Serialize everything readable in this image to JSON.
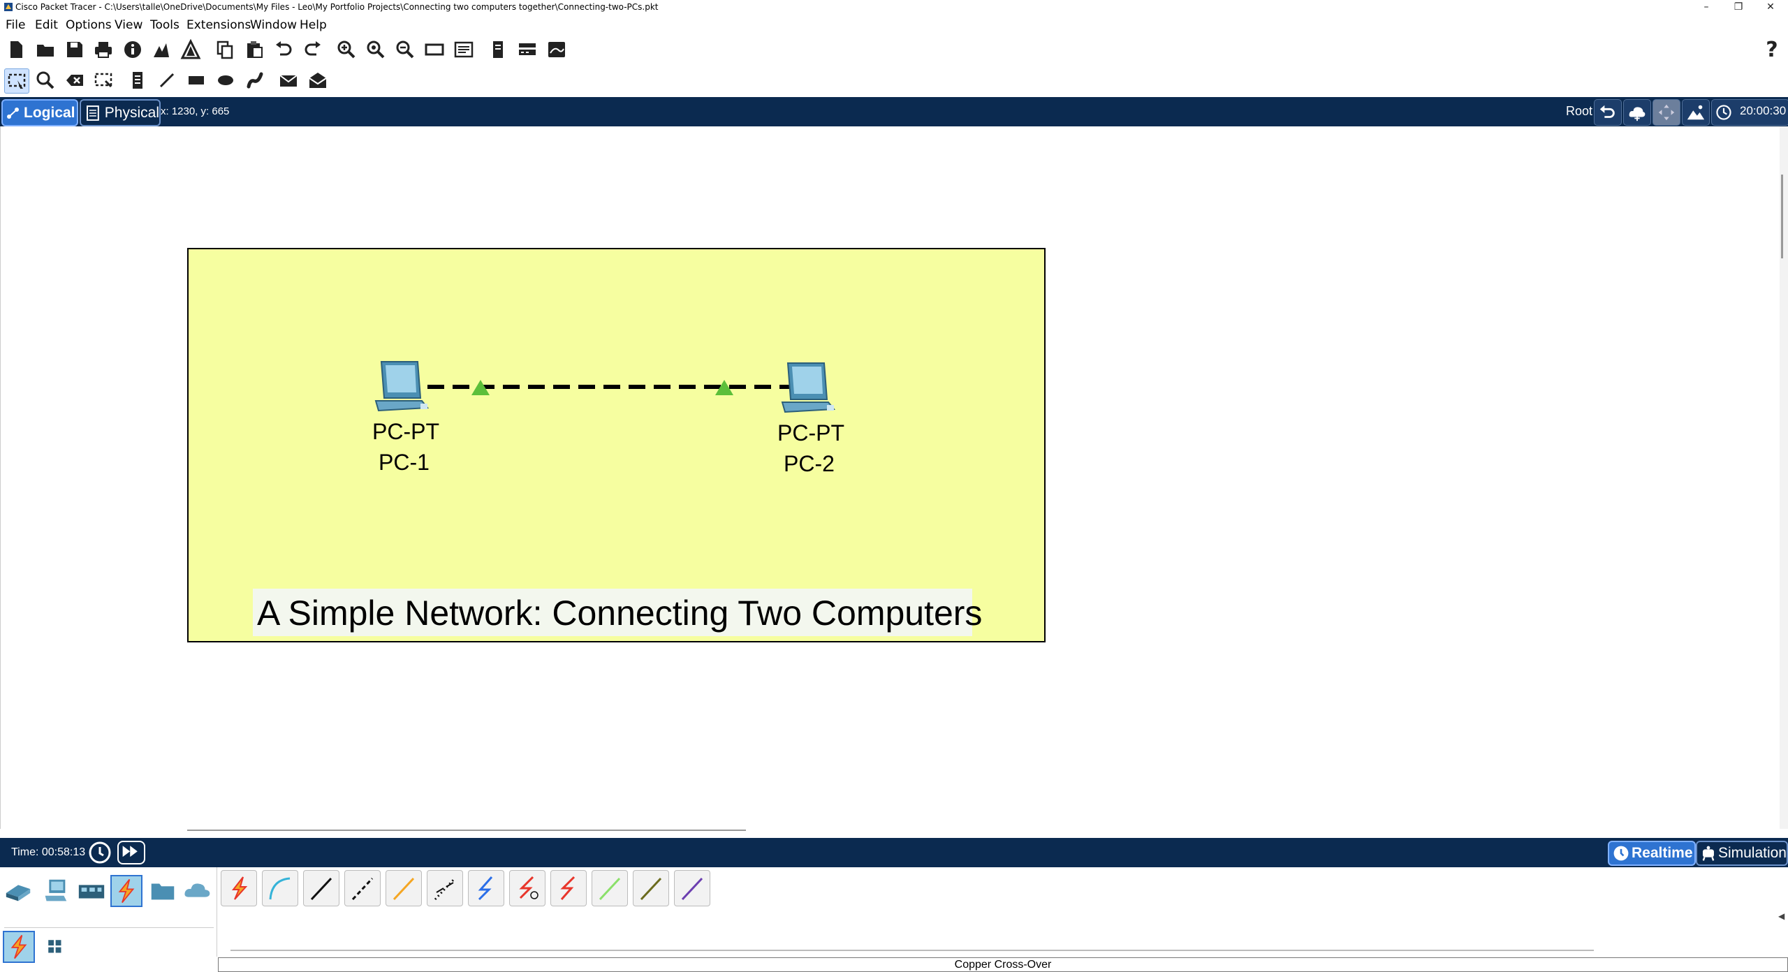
{
  "titlebar": {
    "title": "Cisco Packet Tracer - C:\\Users\\talle\\OneDrive\\Documents\\My Files - Leo\\My Portfolio Projects\\Connecting two computers together\\Connecting-two-PCs.pkt",
    "minimize": "–",
    "maximize": "❐",
    "close": "✕"
  },
  "menu": [
    "File",
    "Edit",
    "Options",
    "View",
    "Tools",
    "Extensions",
    "Window",
    "Help"
  ],
  "toolbar1": {
    "icons": [
      "new-file-icon",
      "open-folder-icon",
      "save-icon",
      "print-icon",
      "info-icon",
      "network-wizard-icon",
      "activity-wizard-icon",
      "copy-icon",
      "paste-icon",
      "undo-icon",
      "redo-icon",
      "zoom-in-icon",
      "zoom-reset-icon",
      "zoom-out-icon",
      "rectangle-view-icon",
      "custom-device-icon",
      "notes-icon",
      "device-dialog-icon",
      "cluster-icon"
    ],
    "help": "?"
  },
  "toolbar2": {
    "icons": [
      "select-icon",
      "inspect-icon",
      "delete-icon",
      "resize-shape-icon",
      "place-note-icon",
      "draw-line-icon",
      "draw-rectangle-icon",
      "draw-ellipse-icon",
      "freeform-icon",
      "add-simple-pdu-icon",
      "add-complex-pdu-icon"
    ]
  },
  "nav": {
    "logical": "Logical",
    "physical": "Physical",
    "coords": "x: 1230, y: 665",
    "root": "Root",
    "time": "20:00:30"
  },
  "canvas": {
    "banner": "A Simple Network:  Connecting Two Computers",
    "devices": [
      {
        "model": "PC-PT",
        "name": "PC-1"
      },
      {
        "model": "PC-PT",
        "name": "PC-2"
      }
    ],
    "link_colors": {
      "line": "#000000",
      "port": "#5cbf3a"
    },
    "box_color": "#f6fea0"
  },
  "bottom": {
    "time": "Time: 00:58:13",
    "realtime": "Realtime",
    "simulation": "Simulation"
  },
  "device_categories": [
    "network-devices-icon",
    "end-devices-icon",
    "components-icon",
    "connections-icon",
    "misc-icon",
    "multiuser-icon"
  ],
  "cables": [
    {
      "name": "automatic-cable",
      "color": "#e8352a"
    },
    {
      "name": "console-cable",
      "color": "#35b3d8"
    },
    {
      "name": "copper-straight-through",
      "color": "#111111"
    },
    {
      "name": "copper-cross-over",
      "color": "#111111"
    },
    {
      "name": "fiber",
      "color": "#f5a623"
    },
    {
      "name": "phone",
      "color": "#111111"
    },
    {
      "name": "coaxial",
      "color": "#2a6ee8"
    },
    {
      "name": "serial-dce",
      "color": "#e8352a"
    },
    {
      "name": "serial-dte",
      "color": "#e8352a"
    },
    {
      "name": "octal",
      "color": "#8be06a"
    },
    {
      "name": "iot-custom",
      "color": "#6b6b1e"
    },
    {
      "name": "usb",
      "color": "#6c3fb0"
    }
  ],
  "status": "Copper Cross-Over"
}
